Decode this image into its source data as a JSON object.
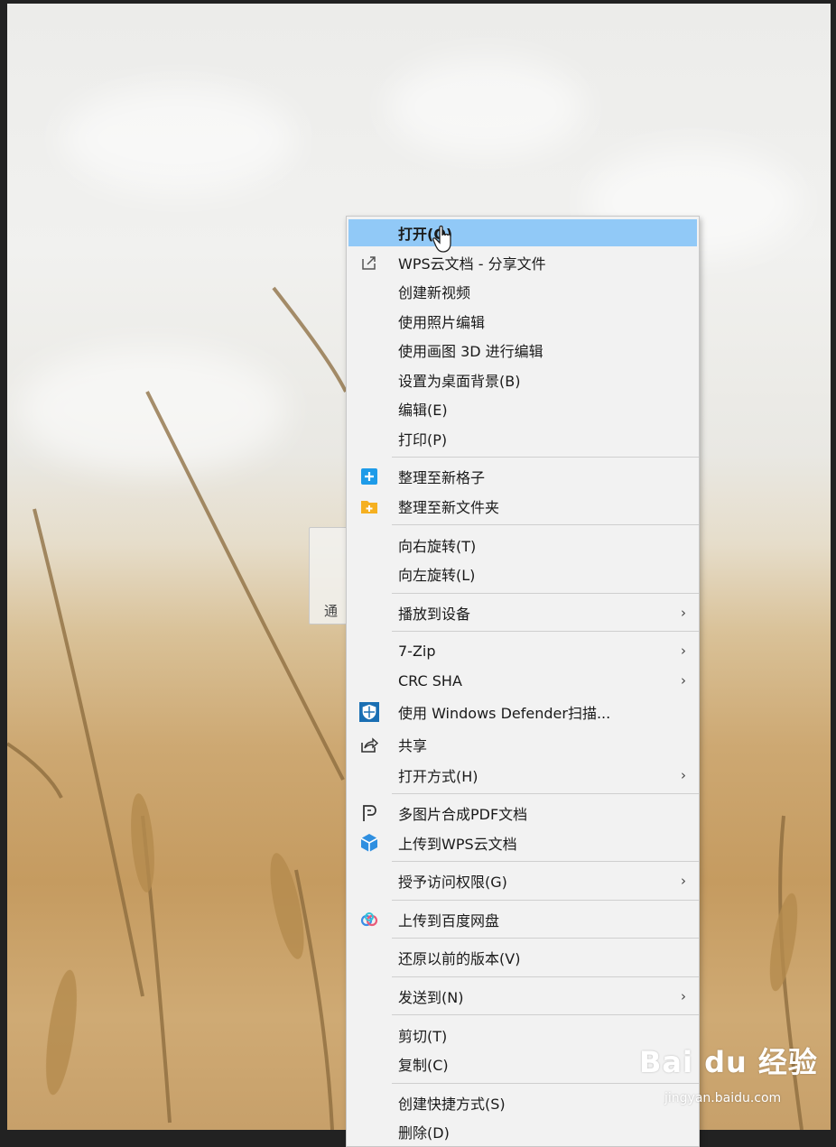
{
  "thumbnail": {
    "label": "通"
  },
  "context_menu": {
    "items": [
      {
        "label": "打开(O)",
        "icon": "none",
        "highlighted": true
      },
      {
        "label": "WPS云文档 - 分享文件",
        "icon": "share-out-icon"
      },
      {
        "label": "创建新视频",
        "icon": "none"
      },
      {
        "label": "使用照片编辑",
        "icon": "none"
      },
      {
        "label": "使用画图 3D 进行编辑",
        "icon": "none"
      },
      {
        "label": "设置为桌面背景(B)",
        "icon": "none"
      },
      {
        "label": "编辑(E)",
        "icon": "none"
      },
      {
        "label": "打印(P)",
        "icon": "none"
      },
      {
        "label": "整理至新格子",
        "icon": "blue-plus-icon"
      },
      {
        "label": "整理至新文件夹",
        "icon": "folder-plus-icon"
      },
      {
        "label": "向右旋转(T)",
        "icon": "none"
      },
      {
        "label": "向左旋转(L)",
        "icon": "none"
      },
      {
        "label": "播放到设备",
        "icon": "none",
        "submenu": true
      },
      {
        "label": "7-Zip",
        "icon": "none",
        "submenu": true
      },
      {
        "label": "CRC SHA",
        "icon": "none",
        "submenu": true
      },
      {
        "label": "使用 Windows Defender扫描...",
        "icon": "defender-shield-icon"
      },
      {
        "label": "共享",
        "icon": "share-icon"
      },
      {
        "label": "打开方式(H)",
        "icon": "none",
        "submenu": true
      },
      {
        "label": "多图片合成PDF文档",
        "icon": "pdf-merge-icon"
      },
      {
        "label": "上传到WPS云文档",
        "icon": "wps-cloud-icon"
      },
      {
        "label": "授予访问权限(G)",
        "icon": "none",
        "submenu": true
      },
      {
        "label": "上传到百度网盘",
        "icon": "baidu-netdisk-icon"
      },
      {
        "label": "还原以前的版本(V)",
        "icon": "none"
      },
      {
        "label": "发送到(N)",
        "icon": "none",
        "submenu": true
      },
      {
        "label": "剪切(T)",
        "icon": "none"
      },
      {
        "label": "复制(C)",
        "icon": "none"
      },
      {
        "label": "创建快捷方式(S)",
        "icon": "none"
      },
      {
        "label": "删除(D)",
        "icon": "none"
      }
    ],
    "submenu_arrow": "›",
    "highlight_color": "#91c9f7"
  },
  "watermark": {
    "brand": "Bai du 经验",
    "url": "jingyan.baidu.com"
  }
}
